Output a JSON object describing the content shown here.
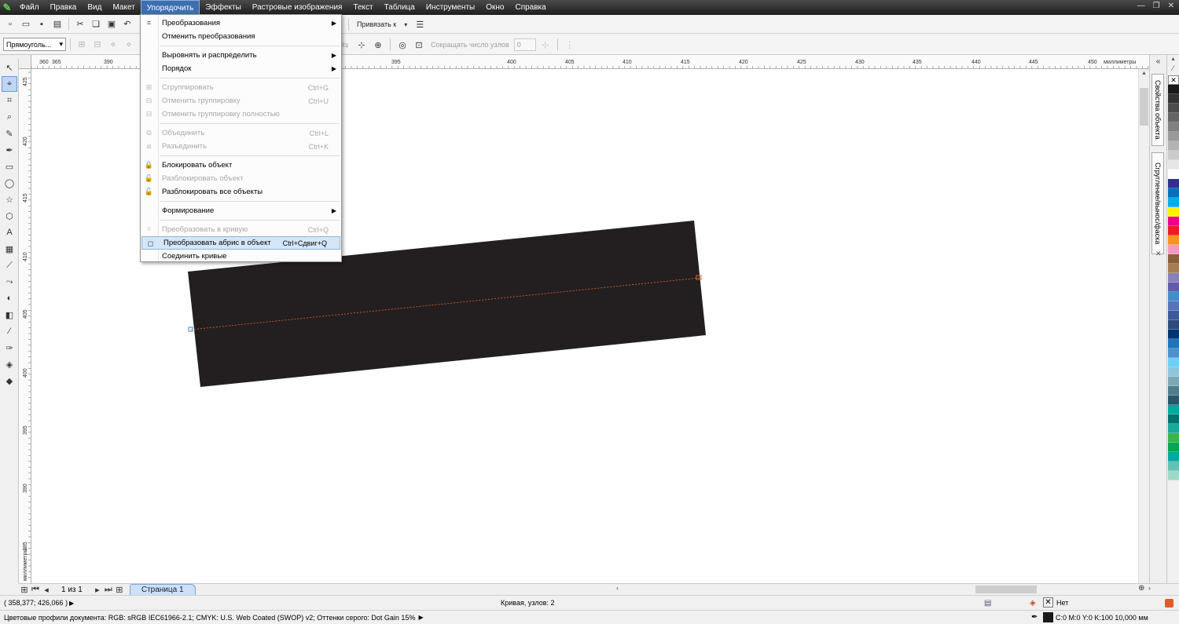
{
  "menubar": {
    "items": [
      "Файл",
      "Правка",
      "Вид",
      "Макет",
      "Упорядочить",
      "Эффекты",
      "Растровые изображения",
      "Текст",
      "Таблица",
      "Инструменты",
      "Окно",
      "Справка"
    ],
    "active_index": 4
  },
  "toolbar": {
    "snap_label": "Привязать к"
  },
  "property_bar": {
    "object_type": "Прямоуголь...",
    "reduce_nodes_label": "Сокращать число узлов",
    "reduce_nodes_value": "0"
  },
  "rulers": {
    "top_ticks": [
      "360",
      "365",
      "390",
      "395",
      "400",
      "405",
      "410",
      "415",
      "420",
      "425",
      "430",
      "435",
      "440",
      "445",
      "450"
    ],
    "top_unit": "миллиметры",
    "left_ticks": [
      "425",
      "420",
      "415",
      "410",
      "405",
      "400",
      "395",
      "390",
      "385"
    ],
    "left_unit": "миллиметры"
  },
  "arrange_menu": {
    "items": [
      {
        "label": "Преобразования",
        "shortcut": "",
        "submenu": true,
        "disabled": false
      },
      {
        "label": "Отменить преобразования",
        "shortcut": "",
        "submenu": false,
        "disabled": false
      },
      {
        "sep": true
      },
      {
        "label": "Выровнять и распределить",
        "shortcut": "",
        "submenu": true,
        "disabled": false
      },
      {
        "label": "Порядок",
        "shortcut": "",
        "submenu": true,
        "disabled": false
      },
      {
        "sep": true
      },
      {
        "label": "Сгруппировать",
        "shortcut": "Ctrl+G",
        "submenu": false,
        "disabled": true
      },
      {
        "label": "Отменить группировку",
        "shortcut": "Ctrl+U",
        "submenu": false,
        "disabled": true
      },
      {
        "label": "Отменить группировку полностью",
        "shortcut": "",
        "submenu": false,
        "disabled": true
      },
      {
        "sep": true
      },
      {
        "label": "Объединить",
        "shortcut": "Ctrl+L",
        "submenu": false,
        "disabled": true
      },
      {
        "label": "Разъединить",
        "shortcut": "Ctrl+K",
        "submenu": false,
        "disabled": true
      },
      {
        "sep": true
      },
      {
        "label": "Блокировать объект",
        "shortcut": "",
        "submenu": false,
        "disabled": false
      },
      {
        "label": "Разблокировать объект",
        "shortcut": "",
        "submenu": false,
        "disabled": true
      },
      {
        "label": "Разблокировать все объекты",
        "shortcut": "",
        "submenu": false,
        "disabled": false
      },
      {
        "sep": true
      },
      {
        "label": "Формирование",
        "shortcut": "",
        "submenu": true,
        "disabled": false
      },
      {
        "sep": true
      },
      {
        "label": "Преобразовать в кривую",
        "shortcut": "Ctrl+Q",
        "submenu": false,
        "disabled": true
      },
      {
        "label": "Преобразовать абрис в объект",
        "shortcut": "Ctrl+Сдвиг+Q",
        "submenu": false,
        "disabled": false,
        "highlighted": true
      },
      {
        "label": "Соединить кривые",
        "shortcut": "",
        "submenu": false,
        "disabled": false
      }
    ]
  },
  "docker": {
    "tab1": "Свойства объекта",
    "tab2": "Сгругление/вынос/фаска"
  },
  "pagebar": {
    "page_counter": "1 из 1",
    "page_tab": "Страница 1"
  },
  "status": {
    "coordinates": "( 358,377; 426,066 )",
    "selection_info": "Кривая, узлов: 2",
    "fill_label": "Нет",
    "outline_info": "C:0 M:0 Y:0 K:100  10,000 мм",
    "color_profiles": "Цветовые профили документа: RGB: sRGB IEC61966-2.1; CMYK: U.S. Web Coated (SWOP) v2; Оттенки серого: Dot Gain 15%"
  },
  "colors": {
    "shape_fill": "#231f20",
    "menubar_active": "#3d6fae",
    "page_tab": "#cde0f6"
  },
  "palette": [
    "#1a1a1a",
    "#333333",
    "#4d4d4d",
    "#666666",
    "#808080",
    "#999999",
    "#b3b3b3",
    "#cccccc",
    "#e6e6e6",
    "#ffffff",
    "#2e3192",
    "#0072bc",
    "#00aeef",
    "#fff200",
    "#ec008c",
    "#ed1c24",
    "#f7941d",
    "#f49ac1",
    "#8b5e3c",
    "#a67c52",
    "#8781bd",
    "#605ca8",
    "#448ccb",
    "#5674b9",
    "#3c5a99",
    "#2e4a7d",
    "#003471",
    "#1b75bb",
    "#4c90cd",
    "#6dcff6",
    "#8dc6dd",
    "#7da7b5",
    "#4f7d8c",
    "#295769",
    "#00a99d",
    "#00746b",
    "#1aa89a",
    "#39b54a",
    "#00a651",
    "#00a99d",
    "#63c2b5",
    "#9ed9c8"
  ],
  "icons": {
    "menu_groups": [
      "transform-icon",
      "group-icon",
      "combine-icon",
      "lock-icon",
      "unlock-icon",
      "unlock-all-icon",
      "convert-curve-icon",
      "outline-to-object-icon"
    ]
  }
}
